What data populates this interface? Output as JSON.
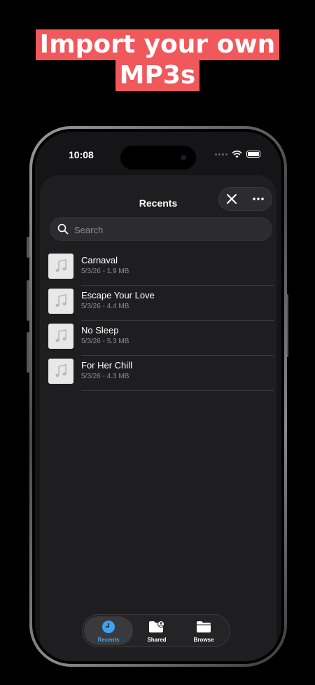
{
  "headline": {
    "line1": "Import your own",
    "line2": "MP3s"
  },
  "status_bar": {
    "time": "10:08"
  },
  "sheet": {
    "title": "Recents"
  },
  "search": {
    "placeholder": "Search"
  },
  "files": [
    {
      "title": "Carnaval",
      "meta": "5/3/26 - 1.9 MB"
    },
    {
      "title": "Escape Your Love",
      "meta": "5/3/26 - 4.4 MB"
    },
    {
      "title": "No Sleep",
      "meta": "5/3/26 - 5.3 MB"
    },
    {
      "title": "For Her Chill",
      "meta": "5/3/26 - 4.3 MB"
    }
  ],
  "tabs": [
    {
      "label": "Recents",
      "icon": "clock-icon",
      "active": true
    },
    {
      "label": "Shared",
      "icon": "shared-folder-icon",
      "active": false
    },
    {
      "label": "Browse",
      "icon": "folder-icon",
      "active": false
    }
  ],
  "colors": {
    "headline_bg": "#f0585c",
    "accent": "#3da1f5",
    "background": "#000000",
    "sheet": "#1e1e20"
  }
}
